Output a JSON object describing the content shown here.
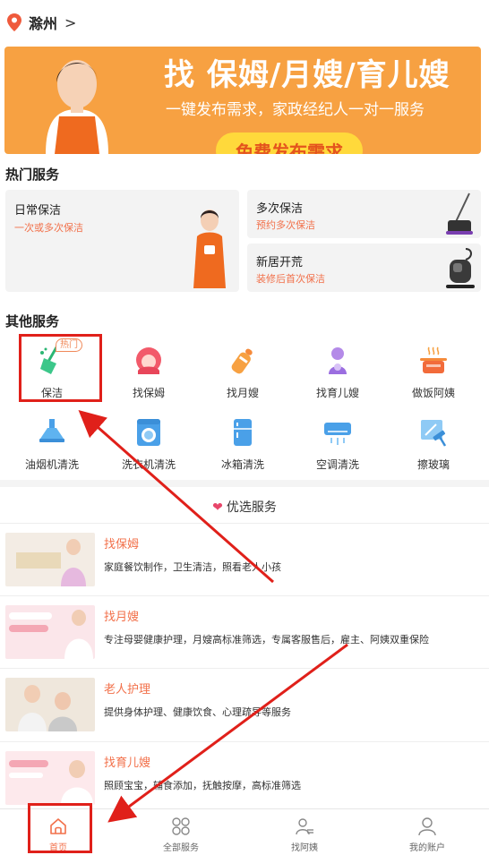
{
  "header": {
    "city": "滁州",
    "chevron": ">"
  },
  "banner": {
    "title": "找 保姆/月嫂/育儿嫂",
    "subtitle": "一键发布需求，家政经纪人一对一服务",
    "cta": "免费发布需求",
    "bg_color": "#f7a142"
  },
  "hot_services": {
    "title": "热门服务",
    "cards": [
      {
        "title": "日常保洁",
        "subtitle": "一次或多次保洁"
      },
      {
        "title": "多次保洁",
        "subtitle": "预约多次保洁"
      },
      {
        "title": "新居开荒",
        "subtitle": "装修后首次保洁"
      }
    ]
  },
  "other_services": {
    "title": "其他服务",
    "hot_tag": "热门",
    "items": [
      {
        "label": "保洁",
        "icon": "broom-icon"
      },
      {
        "label": "找保姆",
        "icon": "nanny-icon"
      },
      {
        "label": "找月嫂",
        "icon": "baby-bottle-icon"
      },
      {
        "label": "找育儿嫂",
        "icon": "caregiver-icon"
      },
      {
        "label": "做饭阿姨",
        "icon": "cooking-pot-icon"
      },
      {
        "label": "油烟机清洗",
        "icon": "range-hood-icon"
      },
      {
        "label": "洗衣机清洗",
        "icon": "washing-machine-icon"
      },
      {
        "label": "冰箱清洗",
        "icon": "fridge-icon"
      },
      {
        "label": "空调清洗",
        "icon": "air-conditioner-icon"
      },
      {
        "label": "擦玻璃",
        "icon": "window-wiper-icon"
      }
    ]
  },
  "featured": {
    "title": "优选服务",
    "items": [
      {
        "title": "找保姆",
        "desc": "家庭餐饮制作，卫生清洁，照看老人小孩"
      },
      {
        "title": "找月嫂",
        "desc": "专注母婴健康护理，月嫂高标准筛选，专属客服售后，雇主、阿姨双重保险"
      },
      {
        "title": "老人护理",
        "desc": "提供身体护理、健康饮食、心理疏导等服务"
      },
      {
        "title": "找育儿嫂",
        "desc": "照顾宝宝，辅食添加，抚触按摩，高标准筛选"
      }
    ]
  },
  "tabbar": {
    "items": [
      {
        "label": "首页",
        "icon": "home-icon",
        "active": true
      },
      {
        "label": "全部服务",
        "icon": "grid-icon",
        "active": false
      },
      {
        "label": "找阿姨",
        "icon": "person-list-icon",
        "active": false
      },
      {
        "label": "我的账户",
        "icon": "user-icon",
        "active": false
      }
    ]
  },
  "colors": {
    "accent": "#f2704a",
    "annotation": "#e0201a"
  }
}
